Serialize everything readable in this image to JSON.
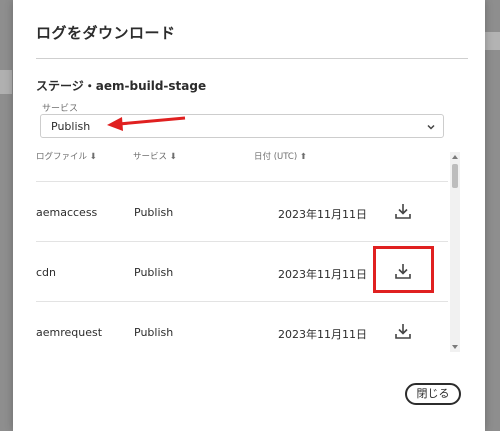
{
  "dialog": {
    "title": "ログをダウンロード",
    "environment_label": "ステージ・aem-build-stage",
    "service_field": {
      "label": "サービス",
      "value": "Publish"
    },
    "table": {
      "headers": {
        "file": "ログファイル ⬇",
        "service": "サービス ⬇",
        "date": "日付 (UTC) ⬆"
      },
      "rows": [
        {
          "file": "aemaccess",
          "service": "Publish",
          "date": "2023年11月11日"
        },
        {
          "file": "cdn",
          "service": "Publish",
          "date": "2023年11月11日"
        },
        {
          "file": "aemrequest",
          "service": "Publish",
          "date": "2023年11月11日"
        }
      ]
    },
    "close_label": "閉じる"
  },
  "icons": {
    "download": "download-icon",
    "chevron": "chevron-down-icon",
    "annotation_arrow": "arrow-left-icon"
  },
  "colors": {
    "annotation_red": "#e02020"
  }
}
